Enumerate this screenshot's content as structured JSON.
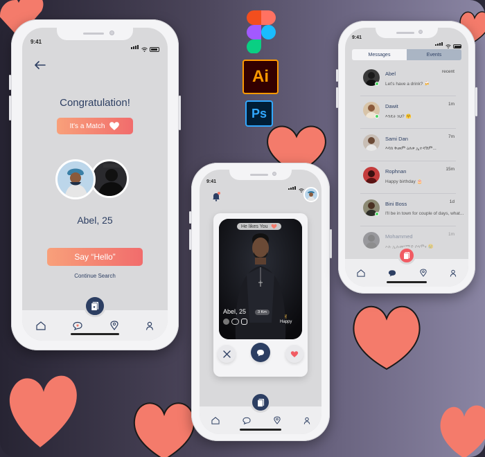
{
  "status_time": "9:41",
  "screen_match": {
    "title": "Congratulation!",
    "match_label": "It's a Match",
    "name_age": "Abel, 25",
    "say_hello_label": "Say “Hello”",
    "continue_label": "Continue Search"
  },
  "screen_swipe": {
    "likes_badge": "He likes You",
    "profile_name": "Abel, 25",
    "distance": "3 Km",
    "mood": "Happy"
  },
  "screen_messages": {
    "tabs": [
      {
        "label": "Messages",
        "active": true
      },
      {
        "label": "Events",
        "active": false
      }
    ],
    "messages": [
      {
        "name": "Abel",
        "preview": "Let's have a drink? 🍻",
        "time": "recent",
        "online": true,
        "color": "#3a3a3a"
      },
      {
        "name": "Dawit",
        "preview": "እንዴት ነህ? 🤗",
        "time": "1m",
        "online": true,
        "color": "#b98a5e"
      },
      {
        "name": "Sami Dan",
        "preview": "እባክ ቅመም ዕለቱ ኢተዳሽም...",
        "time": "7m",
        "online": false,
        "color": "#9a8c82"
      },
      {
        "name": "Rophnan",
        "preview": "Happy birthday 🎂",
        "time": "15m",
        "online": false,
        "color": "#c43c3c"
      },
      {
        "name": "Bini Boss",
        "preview": "I'll be in town for couple of days, what...",
        "time": "1d",
        "online": true,
        "color": "#5c5a4a"
      },
      {
        "name": "Mohammed",
        "preview": "ኦሉ ኢሉመሃሚድ ሶላሞና 😢",
        "time": "1m",
        "online": false,
        "faded": true,
        "color": "#4a4a52"
      }
    ]
  },
  "logos": {
    "illustrator": "Ai",
    "photoshop": "Ps"
  },
  "colors": {
    "accent_navy": "#2c3e62",
    "accent_coral": "#f47b6b",
    "figma_red": "#f24e1e",
    "figma_orange": "#ff7262",
    "figma_purple": "#a259ff",
    "figma_blue": "#1abcfe",
    "figma_green": "#0acf83"
  }
}
